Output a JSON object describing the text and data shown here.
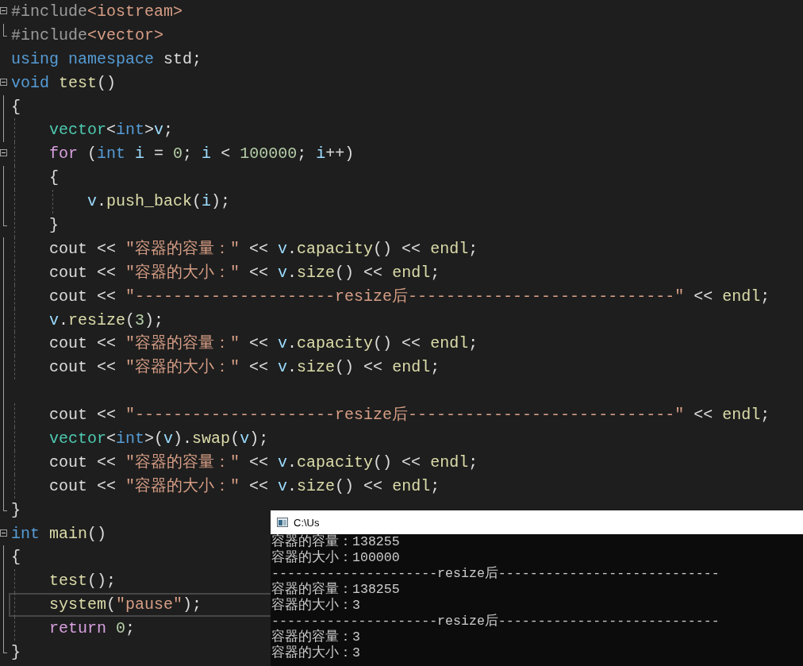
{
  "editor": {
    "lines": [
      {
        "kind": "foldstart",
        "current": false,
        "tokens": [
          {
            "kind": "pre",
            "text": "#include"
          },
          {
            "kind": "path",
            "text": "<iostream>"
          }
        ]
      },
      {
        "kind": "foldend",
        "current": false,
        "tokens": [
          {
            "kind": "pre",
            "text": "#include"
          },
          {
            "kind": "path",
            "text": "<vector>"
          }
        ]
      },
      {
        "kind": "plain",
        "current": false,
        "tokens": [
          {
            "kind": "kw",
            "text": "using"
          },
          {
            "kind": "kw",
            "text": " namespace"
          },
          {
            "kind": "plain",
            "text": " std;"
          }
        ]
      },
      {
        "kind": "foldstart",
        "current": false,
        "tokens": [
          {
            "kind": "kw",
            "text": "void"
          },
          {
            "kind": "fn",
            "text": " test"
          },
          {
            "kind": "plain",
            "text": "()"
          }
        ]
      },
      {
        "kind": "inside",
        "current": false,
        "tokens": [
          {
            "kind": "plain",
            "text": "{"
          }
        ]
      },
      {
        "kind": "inside",
        "current": false,
        "tokens": [
          {
            "kind": "type",
            "text": "    vector"
          },
          {
            "kind": "plain",
            "text": "<"
          },
          {
            "kind": "kw",
            "text": "int"
          },
          {
            "kind": "plain",
            "text": ">"
          },
          {
            "kind": "var",
            "text": "v"
          },
          {
            "kind": "plain",
            "text": ";"
          }
        ]
      },
      {
        "kind": "foldstart",
        "current": false,
        "tokens": [
          {
            "kind": "ctrl",
            "text": "    for"
          },
          {
            "kind": "plain",
            "text": " ("
          },
          {
            "kind": "kw",
            "text": "int"
          },
          {
            "kind": "var",
            "text": " i"
          },
          {
            "kind": "plain",
            "text": " = "
          },
          {
            "kind": "num",
            "text": "0"
          },
          {
            "kind": "plain",
            "text": "; "
          },
          {
            "kind": "var",
            "text": "i"
          },
          {
            "kind": "plain",
            "text": " < "
          },
          {
            "kind": "num",
            "text": "100000"
          },
          {
            "kind": "plain",
            "text": "; "
          },
          {
            "kind": "var",
            "text": "i"
          },
          {
            "kind": "plain",
            "text": "++)"
          }
        ]
      },
      {
        "kind": "inside",
        "current": false,
        "tokens": [
          {
            "kind": "plain",
            "text": "    {"
          }
        ]
      },
      {
        "kind": "inside",
        "current": false,
        "tokens": [
          {
            "kind": "var",
            "text": "        v"
          },
          {
            "kind": "plain",
            "text": "."
          },
          {
            "kind": "fn",
            "text": "push_back"
          },
          {
            "kind": "plain",
            "text": "("
          },
          {
            "kind": "var",
            "text": "i"
          },
          {
            "kind": "plain",
            "text": ");"
          }
        ]
      },
      {
        "kind": "foldend",
        "current": false,
        "tokens": [
          {
            "kind": "plain",
            "text": "    }"
          }
        ]
      },
      {
        "kind": "inside",
        "current": false,
        "tokens": [
          {
            "kind": "plain",
            "text": "    cout << "
          },
          {
            "kind": "str",
            "text": "\"容器的容量：\""
          },
          {
            "kind": "plain",
            "text": " << "
          },
          {
            "kind": "var",
            "text": "v"
          },
          {
            "kind": "plain",
            "text": "."
          },
          {
            "kind": "fn",
            "text": "capacity"
          },
          {
            "kind": "plain",
            "text": "() << "
          },
          {
            "kind": "fn",
            "text": "endl"
          },
          {
            "kind": "plain",
            "text": ";"
          }
        ]
      },
      {
        "kind": "inside",
        "current": false,
        "tokens": [
          {
            "kind": "plain",
            "text": "    cout << "
          },
          {
            "kind": "str",
            "text": "\"容器的大小：\""
          },
          {
            "kind": "plain",
            "text": " << "
          },
          {
            "kind": "var",
            "text": "v"
          },
          {
            "kind": "plain",
            "text": "."
          },
          {
            "kind": "fn",
            "text": "size"
          },
          {
            "kind": "plain",
            "text": "() << "
          },
          {
            "kind": "fn",
            "text": "endl"
          },
          {
            "kind": "plain",
            "text": ";"
          }
        ]
      },
      {
        "kind": "inside",
        "current": false,
        "tokens": [
          {
            "kind": "plain",
            "text": "    cout << "
          },
          {
            "kind": "str",
            "text": "\"---------------------resize后----------------------------\""
          },
          {
            "kind": "plain",
            "text": " << "
          },
          {
            "kind": "fn",
            "text": "endl"
          },
          {
            "kind": "plain",
            "text": ";"
          }
        ]
      },
      {
        "kind": "inside",
        "current": false,
        "tokens": [
          {
            "kind": "var",
            "text": "    v"
          },
          {
            "kind": "plain",
            "text": "."
          },
          {
            "kind": "fn",
            "text": "resize"
          },
          {
            "kind": "plain",
            "text": "("
          },
          {
            "kind": "num",
            "text": "3"
          },
          {
            "kind": "plain",
            "text": ");"
          }
        ]
      },
      {
        "kind": "inside",
        "current": false,
        "tokens": [
          {
            "kind": "plain",
            "text": "    cout << "
          },
          {
            "kind": "str",
            "text": "\"容器的容量：\""
          },
          {
            "kind": "plain",
            "text": " << "
          },
          {
            "kind": "var",
            "text": "v"
          },
          {
            "kind": "plain",
            "text": "."
          },
          {
            "kind": "fn",
            "text": "capacity"
          },
          {
            "kind": "plain",
            "text": "() << "
          },
          {
            "kind": "fn",
            "text": "endl"
          },
          {
            "kind": "plain",
            "text": ";"
          }
        ]
      },
      {
        "kind": "inside",
        "current": false,
        "tokens": [
          {
            "kind": "plain",
            "text": "    cout << "
          },
          {
            "kind": "str",
            "text": "\"容器的大小：\""
          },
          {
            "kind": "plain",
            "text": " << "
          },
          {
            "kind": "var",
            "text": "v"
          },
          {
            "kind": "plain",
            "text": "."
          },
          {
            "kind": "fn",
            "text": "size"
          },
          {
            "kind": "plain",
            "text": "() << "
          },
          {
            "kind": "fn",
            "text": "endl"
          },
          {
            "kind": "plain",
            "text": ";"
          }
        ]
      },
      {
        "kind": "inside",
        "current": false
      },
      {
        "kind": "inside",
        "current": false,
        "tokens": [
          {
            "kind": "plain",
            "text": "    cout << "
          },
          {
            "kind": "str",
            "text": "\"---------------------resize后----------------------------\""
          },
          {
            "kind": "plain",
            "text": " << "
          },
          {
            "kind": "fn",
            "text": "endl"
          },
          {
            "kind": "plain",
            "text": ";"
          }
        ]
      },
      {
        "kind": "inside",
        "current": false,
        "tokens": [
          {
            "kind": "type",
            "text": "    vector"
          },
          {
            "kind": "plain",
            "text": "<"
          },
          {
            "kind": "kw",
            "text": "int"
          },
          {
            "kind": "plain",
            "text": ">("
          },
          {
            "kind": "var",
            "text": "v"
          },
          {
            "kind": "plain",
            "text": ")."
          },
          {
            "kind": "fn",
            "text": "swap"
          },
          {
            "kind": "plain",
            "text": "("
          },
          {
            "kind": "var",
            "text": "v"
          },
          {
            "kind": "plain",
            "text": ");"
          }
        ]
      },
      {
        "kind": "inside",
        "current": false,
        "tokens": [
          {
            "kind": "plain",
            "text": "    cout << "
          },
          {
            "kind": "str",
            "text": "\"容器的容量：\""
          },
          {
            "kind": "plain",
            "text": " << "
          },
          {
            "kind": "var",
            "text": "v"
          },
          {
            "kind": "plain",
            "text": "."
          },
          {
            "kind": "fn",
            "text": "capacity"
          },
          {
            "kind": "plain",
            "text": "() << "
          },
          {
            "kind": "fn",
            "text": "endl"
          },
          {
            "kind": "plain",
            "text": ";"
          }
        ]
      },
      {
        "kind": "inside",
        "current": false,
        "tokens": [
          {
            "kind": "plain",
            "text": "    cout << "
          },
          {
            "kind": "str",
            "text": "\"容器的大小：\""
          },
          {
            "kind": "plain",
            "text": " << "
          },
          {
            "kind": "var",
            "text": "v"
          },
          {
            "kind": "plain",
            "text": "."
          },
          {
            "kind": "fn",
            "text": "size"
          },
          {
            "kind": "plain",
            "text": "() << "
          },
          {
            "kind": "fn",
            "text": "endl"
          },
          {
            "kind": "plain",
            "text": ";"
          }
        ]
      },
      {
        "kind": "foldend",
        "current": false,
        "tokens": [
          {
            "kind": "plain",
            "text": "}"
          }
        ]
      },
      {
        "kind": "foldstart",
        "current": false,
        "tokens": [
          {
            "kind": "kw",
            "text": "int"
          },
          {
            "kind": "fn",
            "text": " main"
          },
          {
            "kind": "plain",
            "text": "()"
          }
        ]
      },
      {
        "kind": "inside",
        "current": false,
        "tokens": [
          {
            "kind": "plain",
            "text": "{"
          }
        ]
      },
      {
        "kind": "inside",
        "current": false,
        "tokens": [
          {
            "kind": "fn",
            "text": "    test"
          },
          {
            "kind": "plain",
            "text": "();"
          }
        ]
      },
      {
        "kind": "inside",
        "current": true,
        "tokens": [
          {
            "kind": "fn",
            "text": "    system"
          },
          {
            "kind": "plain",
            "text": "("
          },
          {
            "kind": "str",
            "text": "\"pause\""
          },
          {
            "kind": "plain",
            "text": ");"
          }
        ]
      },
      {
        "kind": "inside",
        "current": false,
        "tokens": [
          {
            "kind": "ctrl",
            "text": "    return"
          },
          {
            "kind": "num",
            "text": " 0"
          },
          {
            "kind": "plain",
            "text": ";"
          }
        ]
      },
      {
        "kind": "foldend",
        "current": false,
        "tokens": [
          {
            "kind": "plain",
            "text": "}"
          }
        ]
      }
    ]
  },
  "console": {
    "title": "C:\\Us",
    "lines": [
      "容器的容量：138255",
      "容器的大小：100000",
      "---------------------resize后----------------------------",
      "容器的容量：138255",
      "容器的大小：3",
      "---------------------resize后----------------------------",
      "容器的容量：3",
      "容器的大小：3"
    ]
  }
}
